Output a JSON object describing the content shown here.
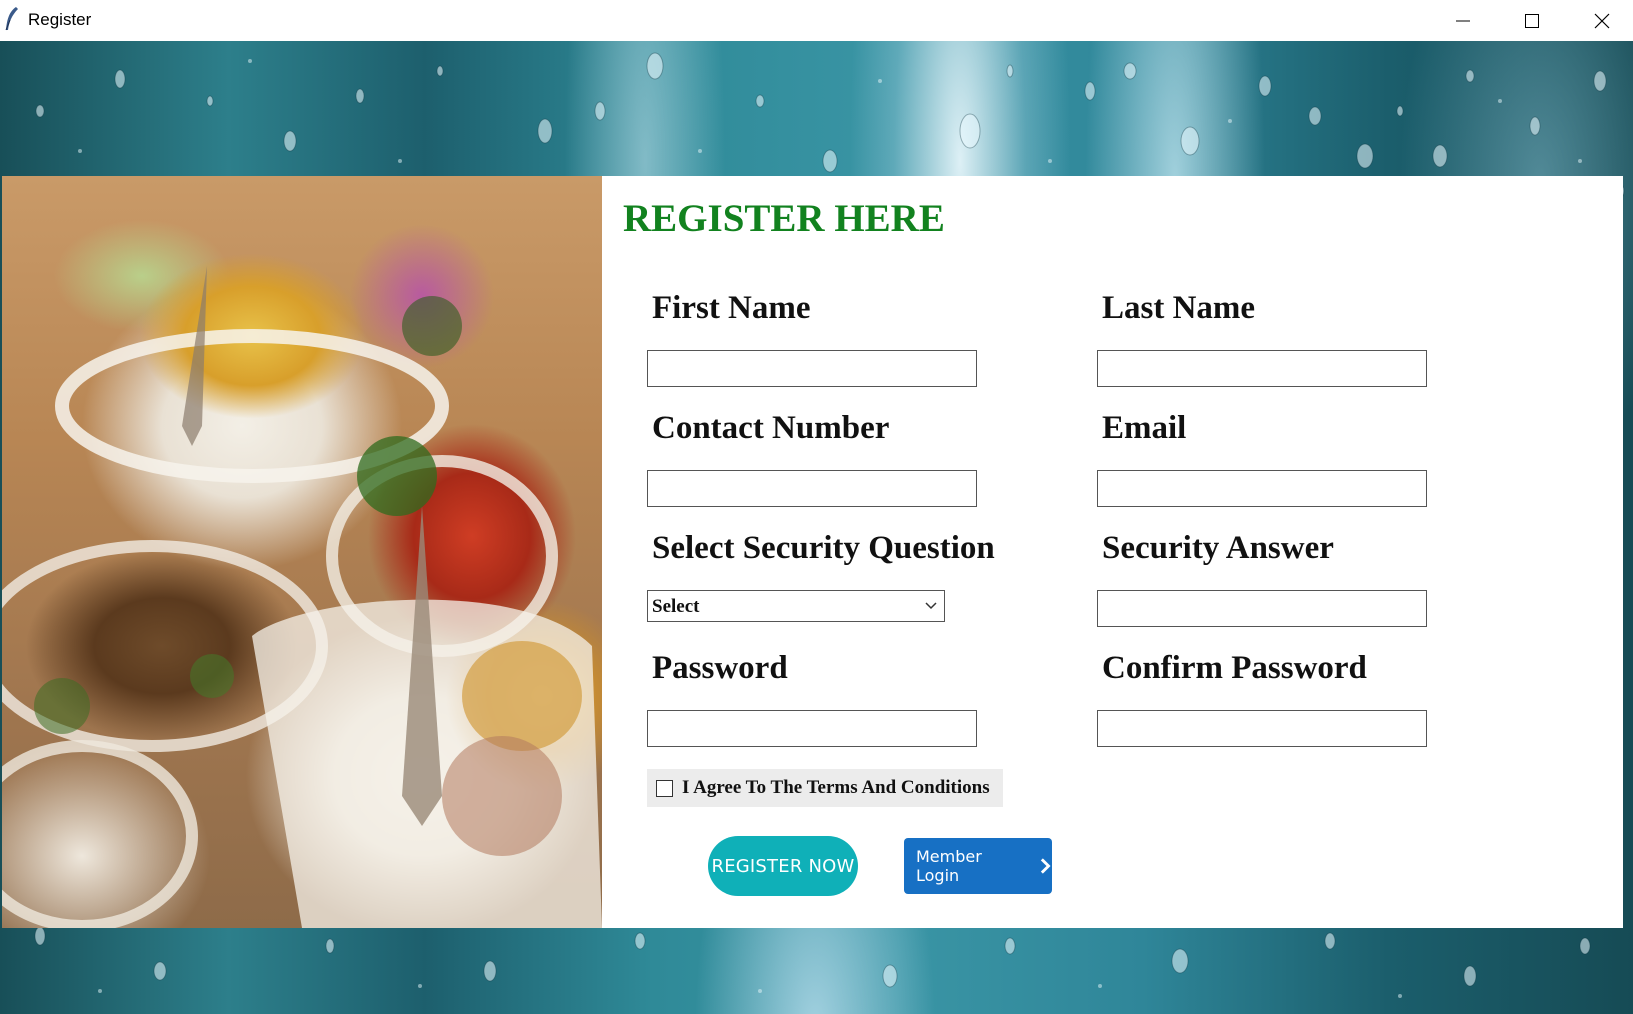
{
  "window": {
    "title": "Register"
  },
  "form": {
    "heading": "REGISTER HERE",
    "first_name": {
      "label": "First Name",
      "value": ""
    },
    "last_name": {
      "label": "Last Name",
      "value": ""
    },
    "contact_number": {
      "label": "Contact Number",
      "value": ""
    },
    "email": {
      "label": "Email",
      "value": ""
    },
    "security_question": {
      "label": "Select Security Question",
      "selected": "Select"
    },
    "security_answer": {
      "label": "Security Answer",
      "value": ""
    },
    "password": {
      "label": "Password",
      "value": ""
    },
    "confirm_password": {
      "label": "Confirm Password",
      "value": ""
    },
    "terms": {
      "label": "I Agree To The Terms And Conditions",
      "checked": false
    },
    "register_button": "REGISTER NOW",
    "login_button": "Member Login"
  },
  "colors": {
    "heading": "#12821f",
    "register_button": "#0fb0b8",
    "login_button": "#1770c4"
  }
}
